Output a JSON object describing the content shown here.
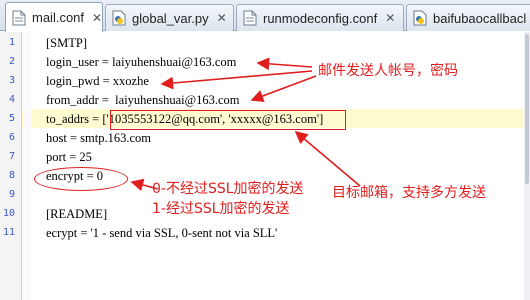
{
  "tabs": [
    {
      "label": "mail.conf",
      "close": "✕",
      "icon": "config-file-icon",
      "active": true
    },
    {
      "label": "global_var.py",
      "close": "✕",
      "icon": "python-file-icon",
      "active": false
    },
    {
      "label": "runmodeconfig.conf",
      "close": "✕",
      "icon": "config-file-icon",
      "active": false
    },
    {
      "label": "baifubaocallbacl",
      "close": "",
      "icon": "python-file-icon",
      "active": false
    }
  ],
  "editor": {
    "lines": [
      {
        "num": "1",
        "text": "[SMTP]"
      },
      {
        "num": "2",
        "text": "login_user = laiyuhenshuai@163.com"
      },
      {
        "num": "3",
        "text": "login_pwd = xxozhe"
      },
      {
        "num": "4",
        "text": "from_addr =  laiyuhenshuai@163.com"
      },
      {
        "num": "5",
        "text": "to_addrs = ['1035553122@qq.com', 'xxxxx@163.com']"
      },
      {
        "num": "6",
        "text": "host = smtp.163.com"
      },
      {
        "num": "7",
        "text": "port = 25"
      },
      {
        "num": "8",
        "text": "encrypt = 0"
      },
      {
        "num": "9",
        "text": ""
      },
      {
        "num": "10",
        "text": "[README]"
      },
      {
        "num": "11",
        "text": "ecrypt = '1 - send via SSL, 0-sent not via SLL'"
      }
    ],
    "current_line": "5"
  },
  "annotations": {
    "sender": "邮件发送人帐号，密码",
    "encrypt_0": "0-不经过SSL加密的发送",
    "encrypt_1": "1-经过SSL加密的发送",
    "receivers": "目标邮箱，支持多方发送",
    "color": "#e01e1e"
  }
}
